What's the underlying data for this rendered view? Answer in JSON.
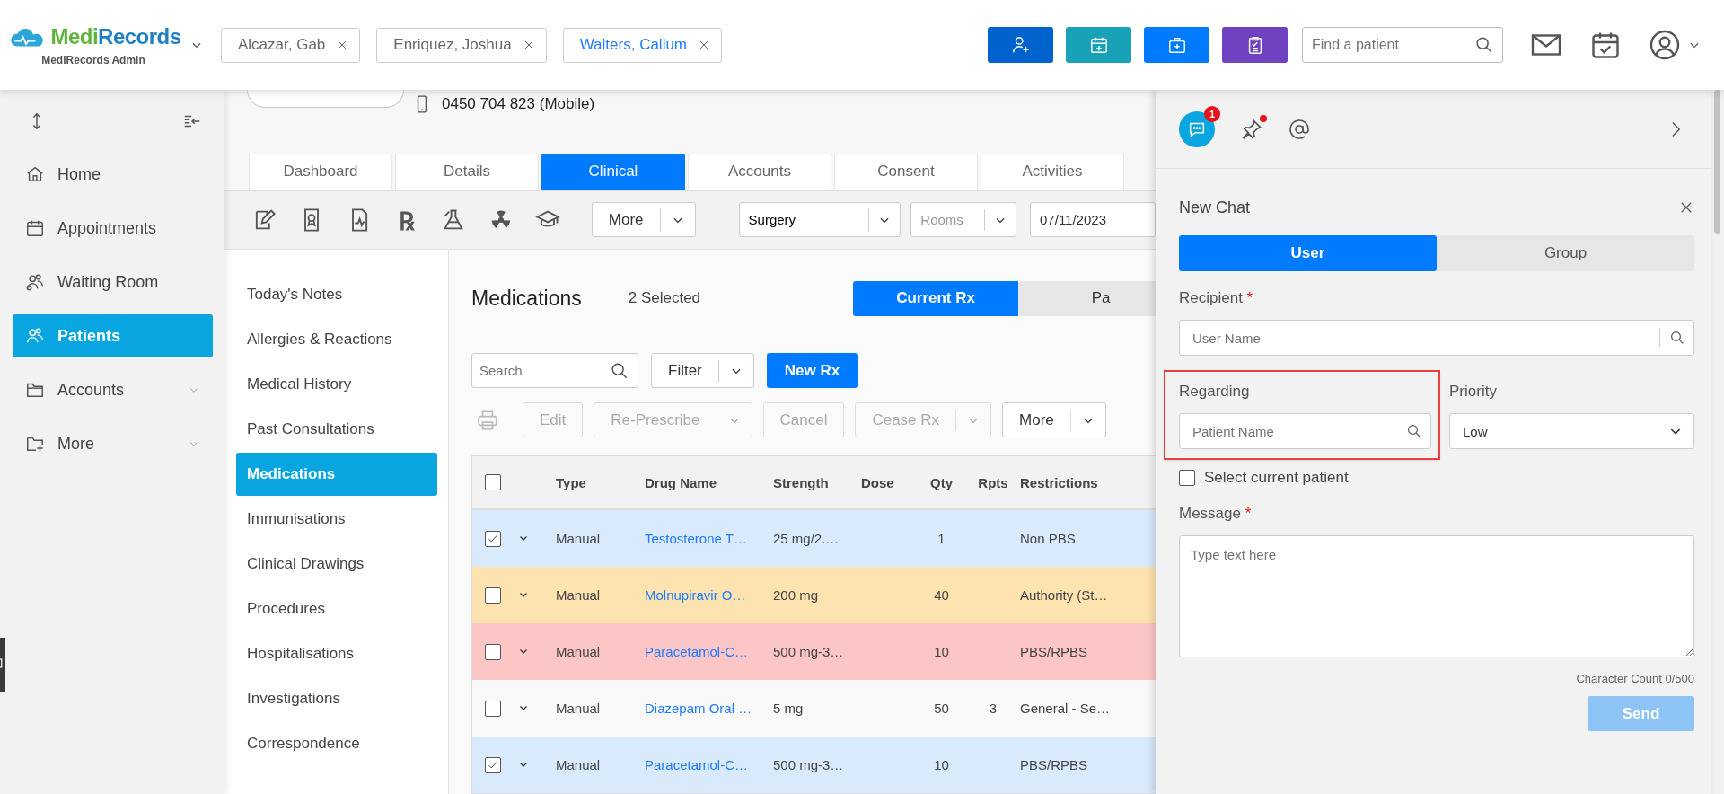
{
  "header": {
    "logo": {
      "brand_first": "Medi",
      "brand_second": "Records",
      "subtitle": "MediRecords Admin"
    },
    "patient_tabs": [
      {
        "label": "Alcazar, Gab",
        "selected": false
      },
      {
        "label": "Enriquez, Joshua",
        "selected": false
      },
      {
        "label": "Walters, Callum",
        "selected": true
      }
    ],
    "quick_actions": [
      {
        "kind": "add-patient",
        "color": "#0062cc"
      },
      {
        "kind": "appointment",
        "color": "#17a2b8"
      },
      {
        "kind": "medical-kit",
        "color": "#007bff"
      },
      {
        "kind": "clipboard",
        "color": "#6f42c1"
      }
    ],
    "search": {
      "placeholder": "Find a patient"
    }
  },
  "sidebar": {
    "items": [
      {
        "label": "Home",
        "selected": false,
        "expandable": false
      },
      {
        "label": "Appointments",
        "selected": false,
        "expandable": false
      },
      {
        "label": "Waiting Room",
        "selected": false,
        "expandable": false
      },
      {
        "label": "Patients",
        "selected": true,
        "expandable": false
      },
      {
        "label": "Accounts",
        "selected": false,
        "expandable": true
      },
      {
        "label": "More",
        "selected": false,
        "expandable": true
      }
    ]
  },
  "patient": {
    "phone": "0450 704 823 (Mobile)"
  },
  "tabs": [
    {
      "label": "Dashboard",
      "selected": false
    },
    {
      "label": "Details",
      "selected": false
    },
    {
      "label": "Clinical",
      "selected": true
    },
    {
      "label": "Accounts",
      "selected": false
    },
    {
      "label": "Consent",
      "selected": false
    },
    {
      "label": "Activities",
      "selected": false
    }
  ],
  "toolbar": {
    "rx_symbol": "℞",
    "more": "More",
    "location": "Surgery",
    "rooms_placeholder": "Rooms",
    "date": "07/11/2023"
  },
  "clinical_menu": [
    {
      "label": "Today's Notes",
      "selected": false
    },
    {
      "label": "Allergies & Reactions",
      "selected": false
    },
    {
      "label": "Medical History",
      "selected": false
    },
    {
      "label": "Past Consultations",
      "selected": false
    },
    {
      "label": "Medications",
      "selected": true
    },
    {
      "label": "Immunisations",
      "selected": false
    },
    {
      "label": "Clinical Drawings",
      "selected": false
    },
    {
      "label": "Procedures",
      "selected": false
    },
    {
      "label": "Hospitalisations",
      "selected": false
    },
    {
      "label": "Investigations",
      "selected": false
    },
    {
      "label": "Correspondence",
      "selected": false
    }
  ],
  "medications": {
    "title": "Medications",
    "selection_count": "2 Selected",
    "views": [
      {
        "label": "Current Rx",
        "selected": true
      },
      {
        "label": "Pa",
        "selected": false
      }
    ],
    "search": {
      "placeholder": "Search"
    },
    "filter": "Filter",
    "new_rx": "New Rx",
    "actions": [
      {
        "label": "Edit",
        "disabled": true,
        "dropdown": false
      },
      {
        "label": "Re-Prescribe",
        "disabled": true,
        "dropdown": true
      },
      {
        "label": "Cancel",
        "disabled": true,
        "dropdown": false
      },
      {
        "label": "Cease Rx",
        "disabled": true,
        "dropdown": true
      },
      {
        "label": "More",
        "disabled": false,
        "dropdown": true
      }
    ],
    "table": {
      "all_checked": false,
      "columns": [
        "Type",
        "Drug Name",
        "Strength",
        "Dose",
        "Qty",
        "Rpts",
        "Restrictions"
      ],
      "rows": [
        {
          "checked": true,
          "color": "#d9eafc",
          "cells": [
            "Manual",
            "Testosterone T…",
            "25 mg/2.…",
            null,
            "1",
            null,
            "Non PBS"
          ]
        },
        {
          "checked": false,
          "color": "#fde3b0",
          "cells": [
            "Manual",
            "Molnupiravir O…",
            "200 mg",
            null,
            "40",
            null,
            "Authority (St…"
          ]
        },
        {
          "checked": false,
          "color": "#fcc6c6",
          "cells": [
            "Manual",
            "Paracetamol-C…",
            "500 mg-3…",
            null,
            "10",
            null,
            "PBS/RPBS"
          ]
        },
        {
          "checked": false,
          "color": "#f9f9f9",
          "cells": [
            "Manual",
            "Diazepam Oral …",
            "5 mg",
            null,
            "50",
            "3",
            "General - Se…"
          ]
        },
        {
          "checked": true,
          "color": "#d9eafc",
          "cells": [
            "Manual",
            "Paracetamol-C…",
            "500 mg-3…",
            null,
            "10",
            null,
            "PBS/RPBS"
          ]
        }
      ]
    }
  },
  "chat": {
    "unread_count": "1",
    "pin_alert": true,
    "title": "New Chat",
    "modes": [
      {
        "label": "User",
        "selected": true
      },
      {
        "label": "Group",
        "selected": false
      }
    ],
    "recipient": {
      "label": "Recipient",
      "required_mark": "*",
      "placeholder": "User Name"
    },
    "regarding": {
      "label": "Regarding",
      "placeholder": "Patient Name",
      "highlighted": true
    },
    "priority": {
      "label": "Priority",
      "value": "Low"
    },
    "select_current": {
      "label": "Select current patient",
      "checked": false
    },
    "message": {
      "label": "Message",
      "required_mark": "*",
      "placeholder": "Type text here"
    },
    "character_count": "Character Count 0/500",
    "send": {
      "label": "Send",
      "disabled": true
    }
  }
}
